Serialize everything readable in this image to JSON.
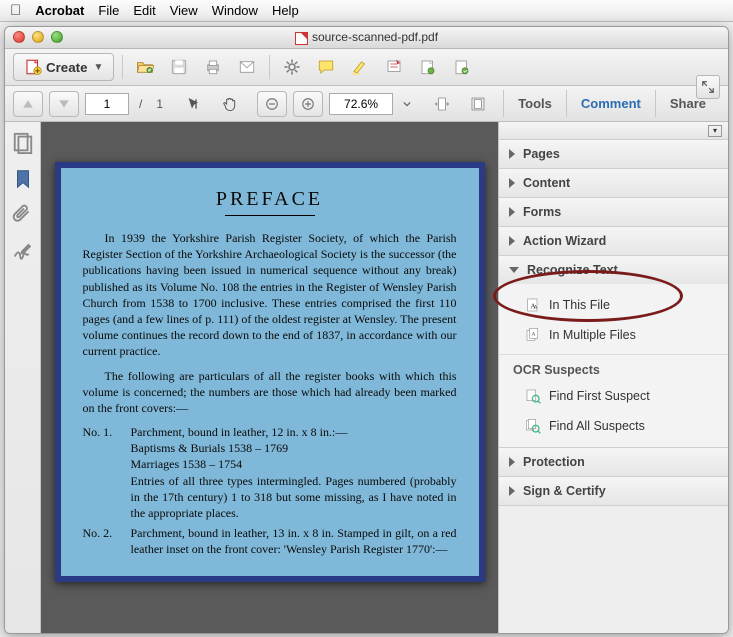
{
  "mac_menu": {
    "appname": "Acrobat",
    "items": [
      "File",
      "Edit",
      "View",
      "Window",
      "Help"
    ]
  },
  "window": {
    "title": "source-scanned-pdf.pdf"
  },
  "toolbar1": {
    "create": "Create"
  },
  "nav": {
    "page": "1",
    "page_sep": "/",
    "page_total": "1",
    "zoom": "72.6%"
  },
  "rtabs": {
    "tools": "Tools",
    "comment": "Comment",
    "share": "Share"
  },
  "rightpanel": {
    "items": [
      {
        "label": "Pages",
        "expanded": false
      },
      {
        "label": "Content",
        "expanded": false
      },
      {
        "label": "Forms",
        "expanded": false
      },
      {
        "label": "Action Wizard",
        "expanded": false
      },
      {
        "label": "Recognize Text",
        "expanded": true,
        "children": {
          "in_this_file": "In This File",
          "in_multiple_files": "In Multiple Files",
          "ocr_hdr": "OCR Suspects",
          "find_first": "Find First Suspect",
          "find_all": "Find All Suspects"
        }
      },
      {
        "label": "Protection",
        "expanded": false
      },
      {
        "label": "Sign & Certify",
        "expanded": false
      }
    ]
  },
  "document": {
    "heading": "PREFACE",
    "para1": "In 1939 the Yorkshire Parish Register Society, of which the Parish Register Section of the Yorkshire Archaeological Society is the successor (the publications having been issued in numerical sequence without any break) published as its Volume No. 108 the entries in the Register of Wensley Parish Church from 1538 to 1700 inclusive. These entries comprised the first 110 pages (and a few lines of p. 111) of the oldest register at Wensley. The present volume continues the record down to the end of 1837, in accordance with our current practice.",
    "para2": "The following are particulars of all the register books with which this volume is concerned; the numbers are those which had already been marked on the front covers:—",
    "no1_label": "No. 1.",
    "no1_text": "Parchment, bound in leather, 12 in. x 8 in.:—\nBaptisms & Burials 1538 – 1769\nMarriages              1538 – 1754\nEntries of all three types intermingled. Pages numbered (probably in the 17th century) 1 to 318 but some missing, as I have noted in the appropriate places.",
    "no2_label": "No. 2.",
    "no2_text": "Parchment, bound in leather, 13 in. x 8 in. Stamped in gilt, on a red leather inset on the front cover: 'Wensley Parish Register 1770':—"
  }
}
